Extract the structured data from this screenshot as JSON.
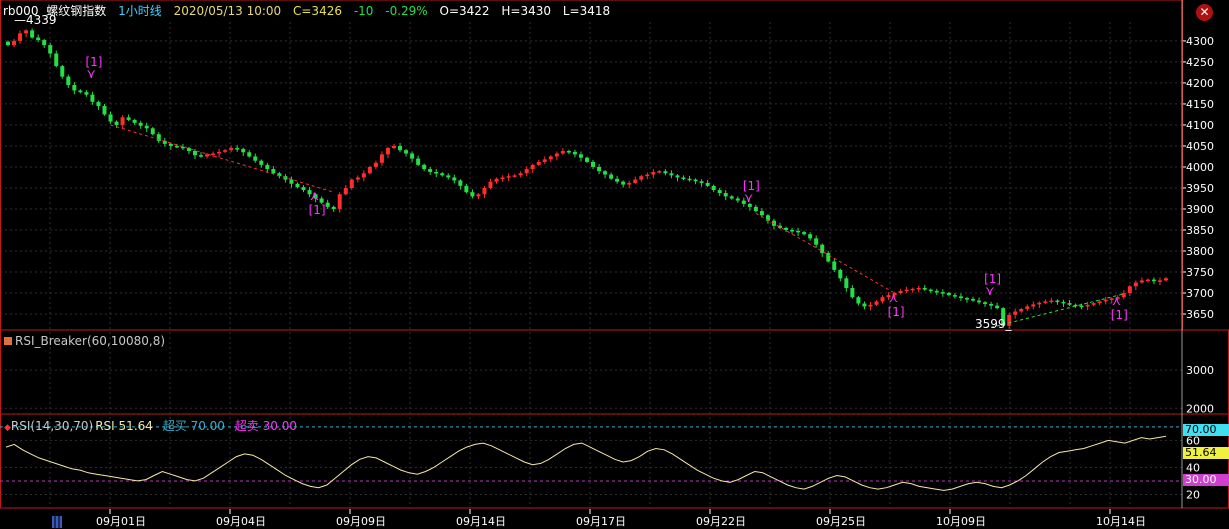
{
  "header": {
    "symbol": "rb000",
    "name": "螺纹钢指数",
    "period": "1小时线",
    "datetime": "2020/05/13 10:00",
    "close": "C=3426",
    "change": "-10",
    "change_pct": "-0.29%",
    "open": "O=3422",
    "high": "H=3430",
    "low": "L=3418"
  },
  "colors": {
    "up": "#ff2d2d",
    "down": "#22e046",
    "grid": "#2f2f2f",
    "border": "#c01818",
    "axis": "#ffffff",
    "signal": "#ff33ff",
    "rsi_line": "#f4e8a8",
    "level_hi": "#3aaed0",
    "level_lo": "#c030c0"
  },
  "chart_data": [
    {
      "type": "candlestick",
      "title": "螺纹钢指数 1小时线",
      "y_ticks": [
        3650,
        3700,
        3750,
        3800,
        3850,
        3900,
        3950,
        4000,
        4050,
        4100,
        4150,
        4200,
        4250,
        4300
      ],
      "ylim": [
        3612,
        4345
      ],
      "x_tick_labels": [
        "09月01日",
        "09月04日",
        "09月09日",
        "09月14日",
        "09月17日",
        "09月22日",
        "09月25日",
        "10月09日",
        "10月14日"
      ],
      "annotations": {
        "high_label": "4339",
        "low_label": "3599",
        "signal_label": "[1]"
      },
      "closes": [
        4290,
        4300,
        4318,
        4325,
        4308,
        4302,
        4290,
        4270,
        4240,
        4215,
        4195,
        4182,
        4178,
        4172,
        4155,
        4145,
        4125,
        4108,
        4100,
        4118,
        4112,
        4105,
        4098,
        4092,
        4078,
        4062,
        4055,
        4050,
        4048,
        4045,
        4038,
        4028,
        4025,
        4030,
        4032,
        4036,
        4040,
        4045,
        4043,
        4035,
        4025,
        4015,
        4005,
        3995,
        3985,
        3978,
        3970,
        3960,
        3952,
        3945,
        3935,
        3925,
        3915,
        3905,
        3900,
        3935,
        3950,
        3970,
        3975,
        3985,
        4000,
        4010,
        4030,
        4045,
        4050,
        4040,
        4032,
        4020,
        4005,
        3995,
        3988,
        3985,
        3980,
        3975,
        3968,
        3955,
        3940,
        3930,
        3935,
        3950,
        3965,
        3972,
        3975,
        3978,
        3980,
        3985,
        3995,
        4005,
        4012,
        4018,
        4025,
        4032,
        4038,
        4036,
        4030,
        4022,
        4012,
        4000,
        3990,
        3982,
        3972,
        3965,
        3958,
        3962,
        3970,
        3978,
        3982,
        3988,
        3990,
        3985,
        3980,
        3975,
        3972,
        3970,
        3966,
        3962,
        3955,
        3945,
        3938,
        3930,
        3925,
        3920,
        3912,
        3905,
        3895,
        3885,
        3872,
        3860,
        3855,
        3850,
        3848,
        3845,
        3840,
        3830,
        3815,
        3795,
        3775,
        3755,
        3735,
        3712,
        3690,
        3675,
        3668,
        3672,
        3680,
        3690,
        3695,
        3700,
        3705,
        3708,
        3710,
        3712,
        3708,
        3705,
        3702,
        3700,
        3695,
        3692,
        3688,
        3686,
        3682,
        3678,
        3674,
        3670,
        3664,
        3622,
        3648,
        3656,
        3662,
        3668,
        3673,
        3677,
        3680,
        3682,
        3679,
        3676,
        3672,
        3670,
        3668,
        3672,
        3676,
        3680,
        3684,
        3687,
        3690,
        3700,
        3716,
        3725,
        3730,
        3732,
        3728,
        3730,
        3735
      ]
    },
    {
      "type": "line",
      "title": "RSI_Breaker(60,10080,8)",
      "y_ticks": [
        2000,
        3000
      ],
      "ylim": [
        1850,
        4000
      ],
      "values": []
    },
    {
      "type": "line",
      "title": "RSI(14,30,70)",
      "series_label": "RSI",
      "current_value": "51.64",
      "overbought_label": "超买",
      "overbought_value": "70.00",
      "oversold_label": "超卖",
      "oversold_value": "30.00",
      "y_ticks": [
        20,
        40,
        60
      ],
      "ylim": [
        10,
        78
      ],
      "values": [
        55,
        57,
        53,
        50,
        47,
        45,
        43,
        41,
        39,
        38,
        36,
        35,
        34,
        33,
        32,
        31,
        30,
        31,
        34,
        37,
        35,
        33,
        31,
        30,
        32,
        36,
        40,
        44,
        48,
        50,
        49,
        46,
        42,
        38,
        34,
        31,
        28,
        26,
        25,
        27,
        32,
        37,
        42,
        46,
        48,
        47,
        44,
        41,
        38,
        36,
        35,
        37,
        40,
        44,
        48,
        52,
        55,
        57,
        58,
        56,
        53,
        50,
        47,
        44,
        42,
        43,
        46,
        50,
        54,
        57,
        58,
        55,
        52,
        49,
        46,
        44,
        45,
        48,
        52,
        54,
        53,
        50,
        46,
        42,
        38,
        35,
        32,
        30,
        29,
        31,
        34,
        37,
        36,
        33,
        30,
        27,
        25,
        24,
        26,
        29,
        32,
        34,
        33,
        30,
        27,
        25,
        24,
        25,
        27,
        29,
        28,
        26,
        25,
        24,
        23,
        24,
        26,
        28,
        29,
        28,
        26,
        25,
        27,
        30,
        34,
        39,
        44,
        48,
        51,
        52,
        53,
        54,
        56,
        58,
        60,
        59,
        58,
        60,
        62,
        61,
        62,
        63
      ]
    }
  ]
}
